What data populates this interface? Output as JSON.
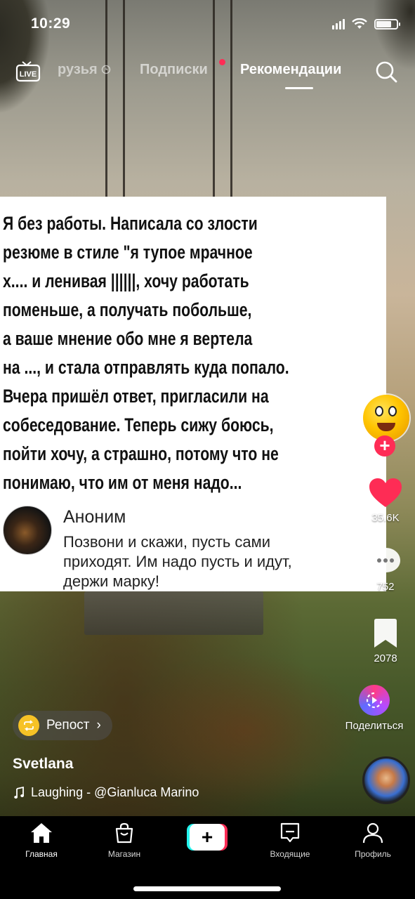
{
  "status_bar": {
    "time": "10:29"
  },
  "top_nav": {
    "tabs": [
      {
        "label": "рузья"
      },
      {
        "label": "Подписки"
      },
      {
        "label": "Рекомендации"
      }
    ]
  },
  "post": {
    "text": "Я без работы. Написала со злости\nрезюме в стиле \"я тупое мрачное\nх.... и ленивая ||||||, хочу работать\nпоменьше, а получать побольше,\nа ваше мнение обо мне я вертела\nна ..., и стала отправлять куда попало.\nВчера пришёл ответ, пригласили на\nсобеседование. Теперь сижу боюсь,\nпойти хочу, а страшно, потому что не\nпонимаю, что им от меня надо...",
    "comment": {
      "author": "Аноним",
      "text": "Позвони и скажи, пусть сами приходят. Им надо пусть и идут, держи марку!"
    }
  },
  "sidebar": {
    "likes": "35.6K",
    "comments": "752",
    "bookmarks": "2078",
    "share_label": "Поделиться"
  },
  "info": {
    "repost_label": "Репост",
    "username": "Svetlana",
    "music": "Laughing - @Gianluca Marino"
  },
  "bottom_nav": {
    "items": [
      {
        "label": "Главная"
      },
      {
        "label": "Магазин"
      },
      {
        "label": "Входящие"
      },
      {
        "label": "Профиль"
      }
    ]
  },
  "colors": {
    "accent": "#fe2c55",
    "accent_cyan": "#25f4ee",
    "repost": "#f6c226"
  }
}
